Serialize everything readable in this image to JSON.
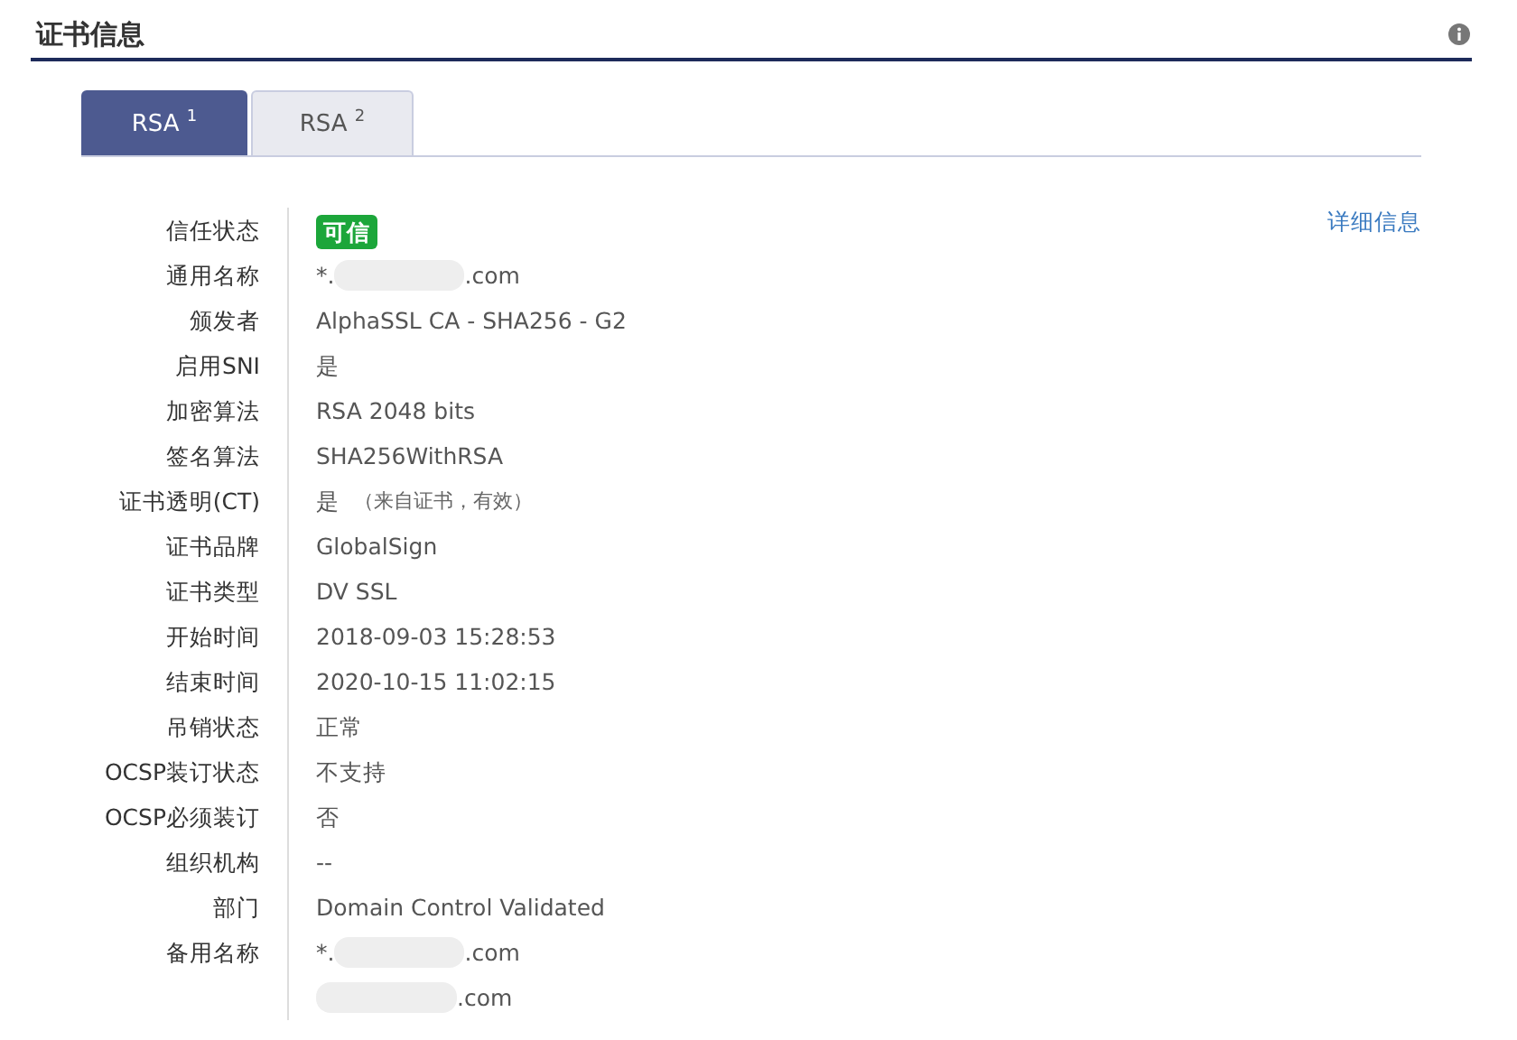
{
  "section": {
    "title": "证书信息"
  },
  "tabs": [
    {
      "label": "RSA",
      "sup": "1",
      "selected": true
    },
    {
      "label": "RSA",
      "sup": "2",
      "selected": false
    }
  ],
  "detail_link": "详细信息",
  "rows": [
    {
      "label": "信任状态",
      "kind": "badge",
      "value": "可信"
    },
    {
      "label": "通用名称",
      "kind": "redacted",
      "values": [
        {
          "prefix": "*.",
          "suffix": ".com"
        }
      ]
    },
    {
      "label": "颁发者",
      "kind": "text",
      "value": "AlphaSSL CA - SHA256 - G2"
    },
    {
      "label": "启用SNI",
      "kind": "text",
      "value": "是"
    },
    {
      "label": "加密算法",
      "kind": "text",
      "value": "RSA 2048 bits"
    },
    {
      "label": "签名算法",
      "kind": "text",
      "value": "SHA256WithRSA"
    },
    {
      "label": "证书透明(CT)",
      "kind": "note",
      "value": "是",
      "note": "（来自证书，有效）"
    },
    {
      "label": "证书品牌",
      "kind": "text",
      "value": "GlobalSign"
    },
    {
      "label": "证书类型",
      "kind": "text",
      "value": "DV SSL"
    },
    {
      "label": "开始时间",
      "kind": "text",
      "value": "2018-09-03 15:28:53"
    },
    {
      "label": "结束时间",
      "kind": "text",
      "value": "2020-10-15 11:02:15"
    },
    {
      "label": "吊销状态",
      "kind": "text",
      "value": "正常"
    },
    {
      "label": "OCSP装订状态",
      "kind": "text",
      "value": "不支持"
    },
    {
      "label": "OCSP必须装订",
      "kind": "text",
      "value": "否"
    },
    {
      "label": "组织机构",
      "kind": "text",
      "value": "--"
    },
    {
      "label": "部门",
      "kind": "text",
      "value": "Domain Control Validated"
    },
    {
      "label": "备用名称",
      "kind": "redacted",
      "values": [
        {
          "prefix": "*.",
          "suffix": ".com"
        },
        {
          "suffix": ".com"
        }
      ]
    }
  ]
}
